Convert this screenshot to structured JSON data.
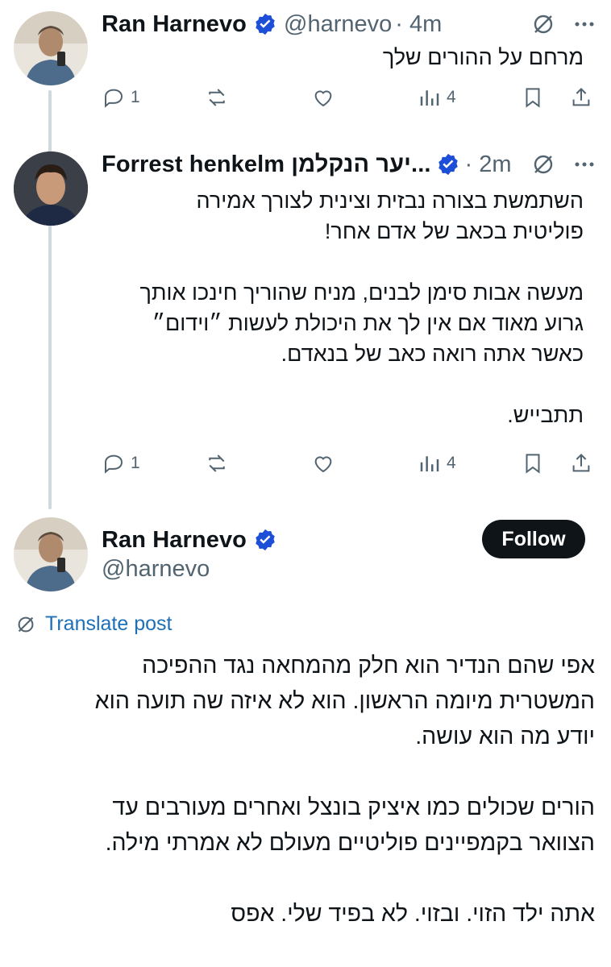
{
  "tweets": [
    {
      "name": "Ran Harnevo",
      "handle": "@harnevo",
      "time": "· 4m",
      "text": [
        "מרחם על ההורים שלך"
      ],
      "stats": {
        "replies": "1",
        "views": "4"
      }
    },
    {
      "name": "Forrest henkelm יער הנקלמן...",
      "time": "· 2m",
      "text": [
        "השתמשת בצורה נבזית וצינית לצורך אמירה",
        "פוליטית בכאב של אדם אחר!",
        "",
        "מעשה אבות סימן לבנים, מניח שהוריך חינכו אותך",
        "גרוע מאוד אם אין לך את היכולת לעשות ״וידום״",
        "כאשר אתה רואה כאב של בנאדם.",
        "",
        "תתבייש."
      ],
      "stats": {
        "replies": "1",
        "views": "4"
      }
    }
  ],
  "main_post": {
    "name": "Ran Harnevo",
    "handle": "@harnevo",
    "follow_label": "Follow",
    "translate_label": "Translate post",
    "text": [
      "אפי שהם הנדיר הוא חלק מהמחאה נגד ההפיכה",
      "המשטרית מיומה הראשון. הוא לא איזה שה תועה הוא",
      "יודע מה הוא עושה.",
      "",
      "הורים שכולים כמו איציק בונצל ואחרים מעורבים עד",
      "הצוואר בקמפיינים פוליטיים מעולם לא אמרתי מילה.",
      "",
      "אתה ילד הזוי. ובזוי. לא בפיד שלי. אפס"
    ]
  },
  "colors": {
    "verified": "#1d4ed8",
    "link": "#1d6fb8",
    "muted": "#536471",
    "line": "#cfd9de"
  }
}
